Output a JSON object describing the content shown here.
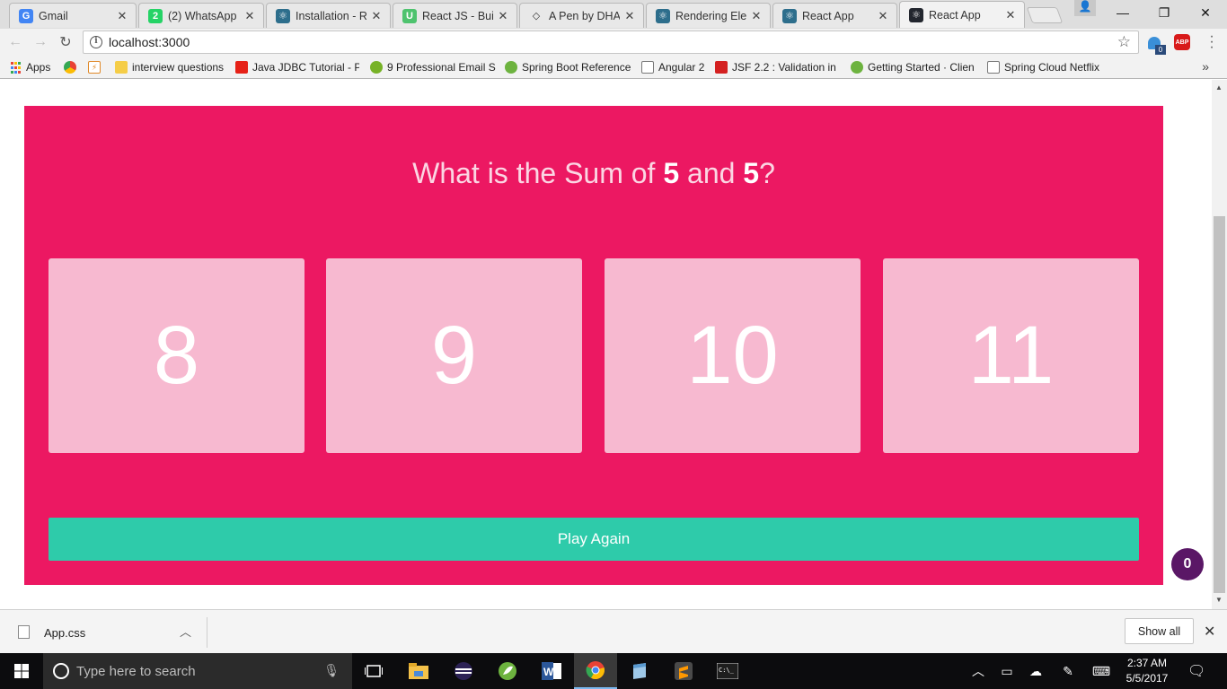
{
  "browser": {
    "tabs": [
      {
        "title": "Gmail",
        "icon": "gmail-icon",
        "color": "#4285f4",
        "glyph": "G"
      },
      {
        "title": "(2) WhatsApp",
        "icon": "whatsapp-icon",
        "color": "#25d366",
        "glyph": "2"
      },
      {
        "title": "Installation - Re",
        "icon": "react-icon",
        "color": "#2d6e8c",
        "glyph": "⚛"
      },
      {
        "title": "React JS - Build",
        "icon": "udemy-icon",
        "color": "#4ec36e",
        "glyph": "U"
      },
      {
        "title": "A Pen by DHAR",
        "icon": "codepen-icon",
        "color": "#e8e8e8",
        "glyph": "◇"
      },
      {
        "title": "Rendering Elem",
        "icon": "react-icon",
        "color": "#2d6e8c",
        "glyph": "⚛"
      },
      {
        "title": "React App",
        "icon": "react-icon",
        "color": "#2d6e8c",
        "glyph": "⚛"
      },
      {
        "title": "React App",
        "icon": "react-icon",
        "color": "#22262e",
        "glyph": "⚛",
        "active": true
      }
    ],
    "tab_close": "✕",
    "window_controls": {
      "minimize": "—",
      "restore": "❐",
      "close": "✕"
    },
    "address": "localhost:3000",
    "nav": {
      "back": "←",
      "forward": "→",
      "reload": "↻"
    },
    "extensions": [
      {
        "name": "ghostery-icon",
        "color": "#3a8fd8",
        "label": "0"
      },
      {
        "name": "adblock-icon",
        "color": "#d81a1a",
        "label": "ABP"
      }
    ],
    "bookmarks_label_apps": "Apps",
    "bookmarks": [
      {
        "label": "interview questions",
        "icon": "folder-icon",
        "color": "#f5cd47"
      },
      {
        "label": "Java JDBC Tutorial - P",
        "icon": "youtube-icon",
        "color": "#e62117"
      },
      {
        "label": "9 Professional Email S",
        "icon": "yoast-icon",
        "color": "#77b227"
      },
      {
        "label": "Spring Boot Reference",
        "icon": "spring-icon",
        "color": "#6db33f"
      },
      {
        "label": "Angular 2",
        "icon": "page-icon",
        "color": "#ffffff"
      },
      {
        "label": "JSF 2.2 : Validation in",
        "icon": "jsf-icon",
        "color": "#d42020"
      },
      {
        "label": "Getting Started · Clien",
        "icon": "spring-icon",
        "color": "#6db33f"
      },
      {
        "label": "Spring Cloud Netflix",
        "icon": "page-icon",
        "color": "#ffffff"
      }
    ],
    "bookmarks_more": "»"
  },
  "game": {
    "question_prefix": "What is the Sum of ",
    "num1": "5",
    "question_mid": " and ",
    "num2": "5",
    "question_suffix": "?",
    "answers": [
      "8",
      "9",
      "10",
      "11"
    ],
    "play_again": "Play Again",
    "score_badge": "0",
    "colors": {
      "background": "#ec1862",
      "answer_box": "#f7b9d0",
      "button": "#2ecbaa",
      "badge": "#5a1766"
    }
  },
  "downloads": {
    "file": "App.css",
    "show_all": "Show all"
  },
  "taskbar": {
    "search_placeholder": "Type here to search",
    "time": "2:37 AM",
    "date": "5/5/2017"
  }
}
